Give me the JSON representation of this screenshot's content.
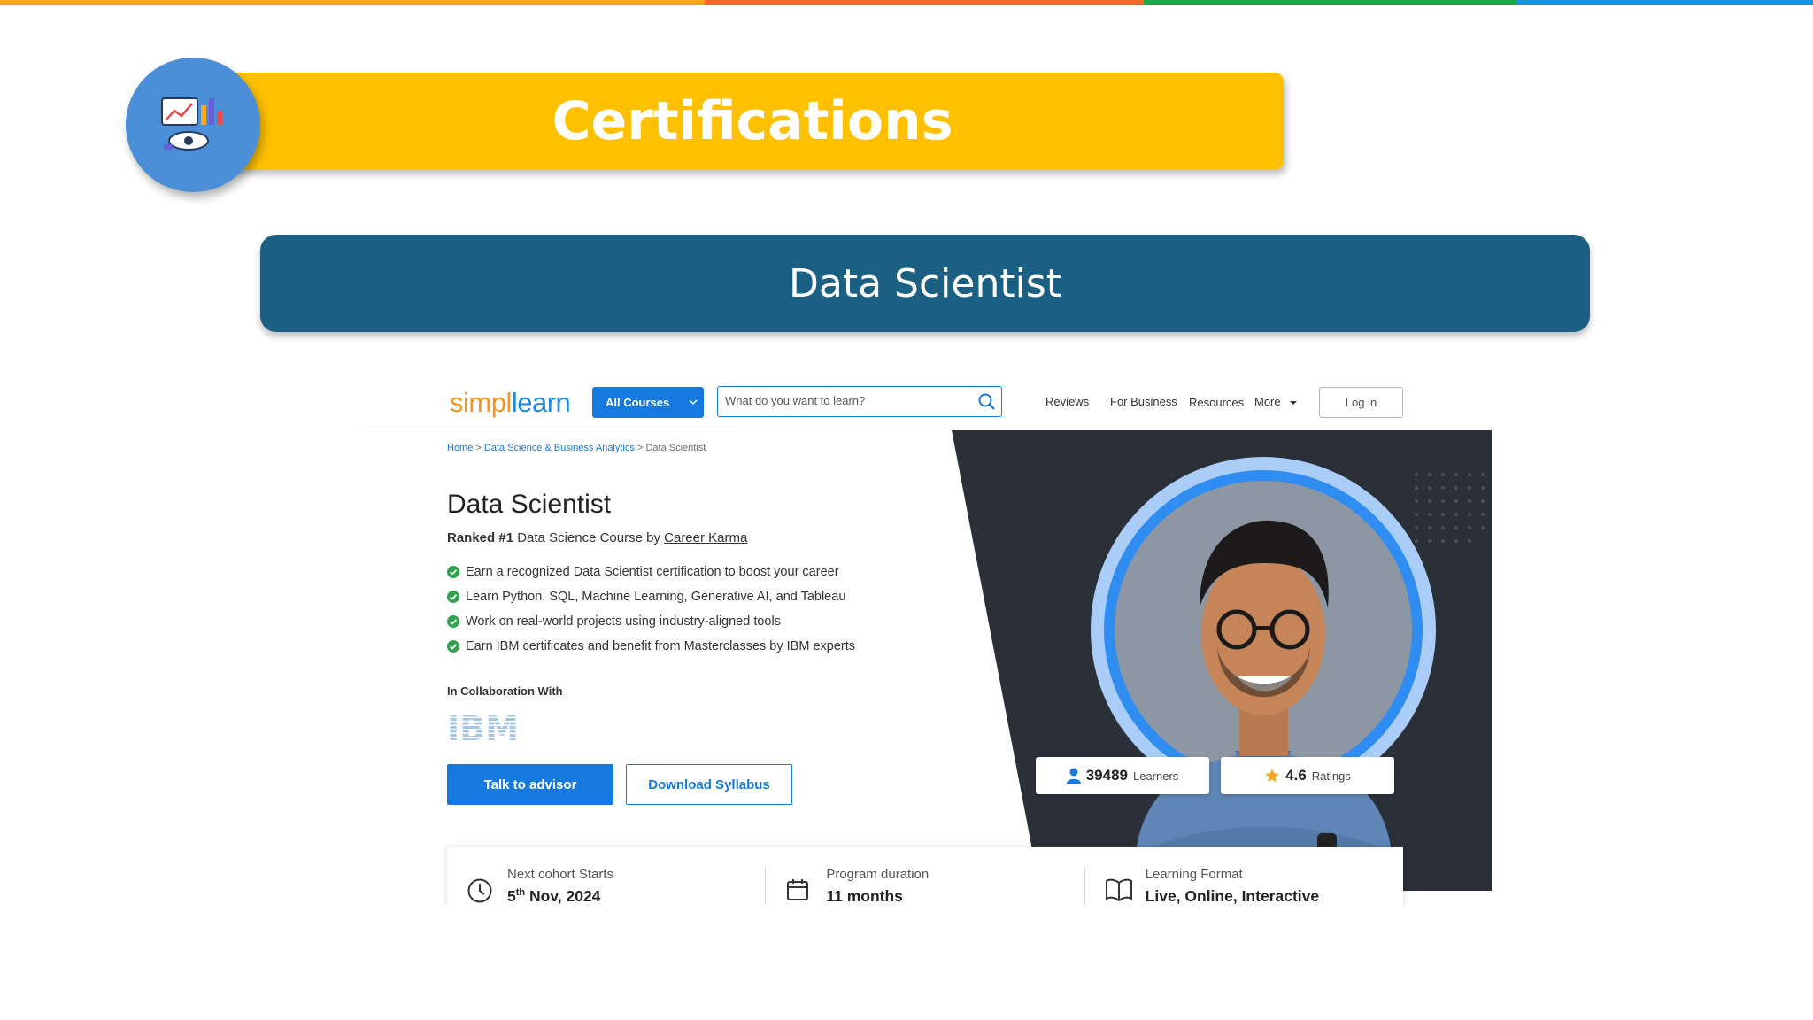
{
  "slide": {
    "top_stripe_colors": [
      "#f7a823",
      "#ef6a2c",
      "#24a046",
      "#1f8fd8"
    ],
    "title": "Certifications",
    "subtitle": "Data Scientist",
    "badge_icon": "analytics-dashboard-icon",
    "colors": {
      "banner": "#ffc000",
      "subtitle_bar": "#1b5f82",
      "badge": "#4a8fd8"
    }
  },
  "nav": {
    "logo_part1": "simpl",
    "logo_part2": "learn",
    "all_courses": "All Courses",
    "search_placeholder": "What do you want to learn?",
    "links": [
      "Reviews",
      "For Business",
      "Resources",
      "More"
    ],
    "login": "Log in"
  },
  "breadcrumb": {
    "home": "Home",
    "sep": ">",
    "category": "Data Science & Business Analytics",
    "current": "Data Scientist"
  },
  "course": {
    "title": "Data Scientist",
    "ranked_bold": "Ranked #1",
    "ranked_text": "Data Science Course by",
    "ranked_source": "Career Karma",
    "features": [
      "Earn a recognized Data Scientist certification to boost your career",
      "Learn Python, SQL, Machine Learning, Generative AI, and Tableau",
      "Work on real-world projects using industry-aligned tools",
      "Earn IBM certificates and benefit from Masterclasses by IBM experts"
    ],
    "collab_label": "In Collaboration With",
    "partner": "IBM",
    "cta_primary": "Talk to advisor",
    "cta_secondary": "Download Syllabus"
  },
  "stats": {
    "learners_count": "39489",
    "learners_label": "Learners",
    "rating_value": "4.6",
    "rating_label": "Ratings"
  },
  "info": {
    "cohort_label": "Next cohort Starts",
    "cohort_day": "5",
    "cohort_suffix": "th",
    "cohort_rest": "Nov, 2024",
    "duration_label": "Program duration",
    "duration_value": "11 months",
    "format_label": "Learning Format",
    "format_value": "Live, Online, Interactive"
  }
}
